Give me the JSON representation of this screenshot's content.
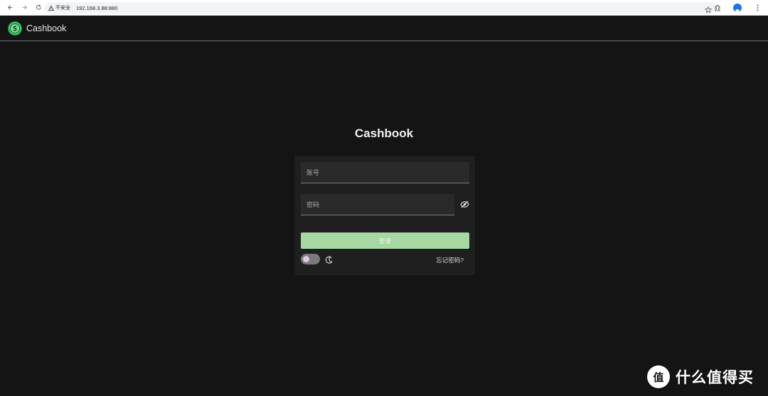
{
  "browser": {
    "security_label": "不安全",
    "url": "192.168.3.88:880"
  },
  "app": {
    "logo_text": "$",
    "brand": "Cashbook"
  },
  "login": {
    "title": "Cashbook",
    "username_placeholder": "账号",
    "password_placeholder": "密码",
    "login_button": "登录",
    "forgot_link": "忘记密码?",
    "dark_mode": false
  },
  "watermark": {
    "logo_glyph": "值",
    "text": "什么值得买"
  },
  "colors": {
    "page_bg": "#141414",
    "card_bg": "#1f1f1f",
    "button_green": "#a6d8a4",
    "logo_green": "#3ccf6d"
  }
}
